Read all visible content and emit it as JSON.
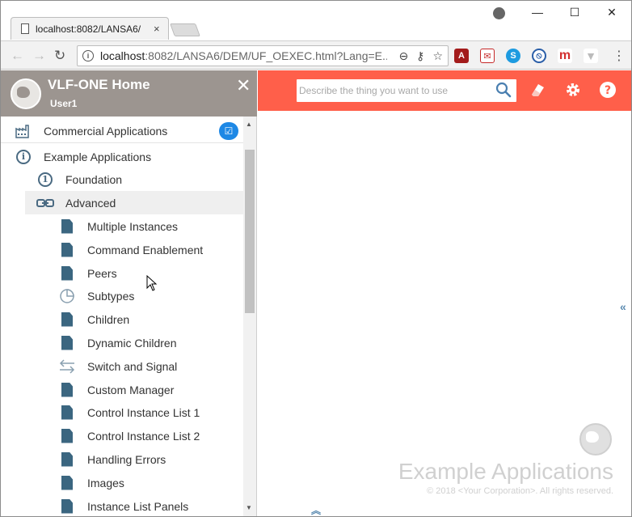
{
  "browser": {
    "tab_title": "localhost:8082/LANSA6/",
    "tab_close": "×",
    "url_host": "localhost",
    "url_path": ":8082/LANSA6/DEM/UF_OEXEC.html?Lang=E...",
    "win_minimize": "—",
    "win_maximize": "☐",
    "win_close": "✕"
  },
  "sidebar": {
    "title": "VLF-ONE Home",
    "user": "User1",
    "close": "✕",
    "items": [
      {
        "label": "Commercial Applications",
        "icon": "factory-icon"
      },
      {
        "label": "Example Applications",
        "icon": "info-icon"
      },
      {
        "label": "Foundation",
        "icon": "number-one-icon",
        "number": "1"
      },
      {
        "label": "Advanced",
        "icon": "link-icon"
      },
      {
        "label": "Multiple Instances",
        "icon": "document-icon"
      },
      {
        "label": "Command Enablement",
        "icon": "document-icon"
      },
      {
        "label": "Peers",
        "icon": "document-icon"
      },
      {
        "label": "Subtypes",
        "icon": "pie-chart-icon"
      },
      {
        "label": "Children",
        "icon": "document-icon"
      },
      {
        "label": "Dynamic Children",
        "icon": "document-icon"
      },
      {
        "label": "Switch and Signal",
        "icon": "switch-arrows-icon"
      },
      {
        "label": "Custom Manager",
        "icon": "document-icon"
      },
      {
        "label": "Control Instance List 1",
        "icon": "document-icon"
      },
      {
        "label": "Control Instance List 2",
        "icon": "document-icon"
      },
      {
        "label": "Handling Errors",
        "icon": "document-icon"
      },
      {
        "label": "Images",
        "icon": "document-icon"
      },
      {
        "label": "Instance List Panels",
        "icon": "document-icon"
      }
    ]
  },
  "search": {
    "placeholder": "Describe the thing you want to use"
  },
  "main": {
    "brand_title": "Example Applications",
    "copyright": "© 2018 <Your Corporation>. All rights reserved."
  },
  "colors": {
    "accent": "#ff5f4a",
    "sidebar_header": "#9c9590",
    "icon_blue": "#3b6680",
    "badge_blue": "#1e88e5"
  }
}
